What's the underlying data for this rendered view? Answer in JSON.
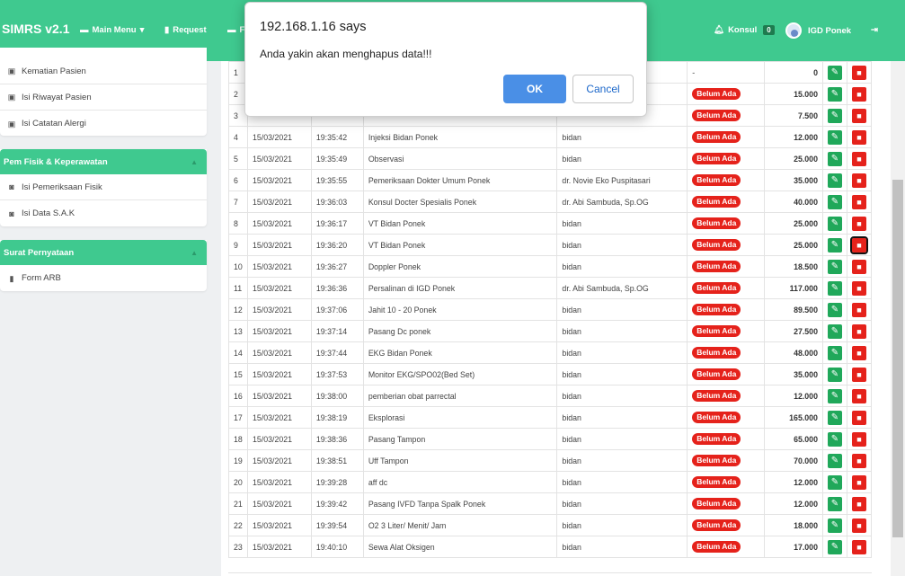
{
  "navbar": {
    "brand": "SIMRS v2.1",
    "main_menu": "Main Menu",
    "request": "Request",
    "third_item": "F",
    "konsul": "Konsul",
    "konsul_count": "0",
    "user": "IGD Ponek"
  },
  "sidebar": {
    "panel1": {
      "items": [
        "Kematian Pasien",
        "Isi Riwayat Pasien",
        "Isi Catatan Alergi"
      ]
    },
    "panel2": {
      "title": "Pem Fisik & Keperawatan",
      "items": [
        "Isi Pemeriksaan Fisik",
        "Isi Data S.A.K"
      ]
    },
    "panel3": {
      "title": "Surat Pernyataan",
      "items": [
        "Form ARB"
      ]
    }
  },
  "table": {
    "rows": [
      {
        "no": "1",
        "date": "",
        "time": "",
        "name": "",
        "petugas": "",
        "status": "-",
        "tarif": "0"
      },
      {
        "no": "2",
        "date": "",
        "time": "",
        "name": "",
        "petugas": "",
        "status": "Belum Ada",
        "tarif": "15.000"
      },
      {
        "no": "3",
        "date": "",
        "time": "",
        "name": "",
        "petugas": "",
        "status": "Belum Ada",
        "tarif": "7.500"
      },
      {
        "no": "4",
        "date": "15/03/2021",
        "time": "19:35:42",
        "name": "Injeksi Bidan Ponek",
        "petugas": "bidan",
        "status": "Belum Ada",
        "tarif": "12.000"
      },
      {
        "no": "5",
        "date": "15/03/2021",
        "time": "19:35:49",
        "name": "Observasi",
        "petugas": "bidan",
        "status": "Belum Ada",
        "tarif": "25.000"
      },
      {
        "no": "6",
        "date": "15/03/2021",
        "time": "19:35:55",
        "name": "Pemeriksaan Dokter Umum Ponek",
        "petugas": "dr. Novie Eko Puspitasari",
        "status": "Belum Ada",
        "tarif": "35.000"
      },
      {
        "no": "7",
        "date": "15/03/2021",
        "time": "19:36:03",
        "name": "Konsul Docter Spesialis Ponek",
        "petugas": "dr. Abi Sambuda, Sp.OG",
        "status": "Belum Ada",
        "tarif": "40.000"
      },
      {
        "no": "8",
        "date": "15/03/2021",
        "time": "19:36:17",
        "name": "VT Bidan Ponek",
        "petugas": "bidan",
        "status": "Belum Ada",
        "tarif": "25.000"
      },
      {
        "no": "9",
        "date": "15/03/2021",
        "time": "19:36:20",
        "name": "VT Bidan Ponek",
        "petugas": "bidan",
        "status": "Belum Ada",
        "tarif": "25.000"
      },
      {
        "no": "10",
        "date": "15/03/2021",
        "time": "19:36:27",
        "name": "Doppler Ponek",
        "petugas": "bidan",
        "status": "Belum Ada",
        "tarif": "18.500"
      },
      {
        "no": "11",
        "date": "15/03/2021",
        "time": "19:36:36",
        "name": "Persalinan di IGD Ponek",
        "petugas": "dr. Abi Sambuda, Sp.OG",
        "status": "Belum Ada",
        "tarif": "117.000"
      },
      {
        "no": "12",
        "date": "15/03/2021",
        "time": "19:37:06",
        "name": "Jahit 10 - 20 Ponek",
        "petugas": "bidan",
        "status": "Belum Ada",
        "tarif": "89.500"
      },
      {
        "no": "13",
        "date": "15/03/2021",
        "time": "19:37:14",
        "name": "Pasang Dc ponek",
        "petugas": "bidan",
        "status": "Belum Ada",
        "tarif": "27.500"
      },
      {
        "no": "14",
        "date": "15/03/2021",
        "time": "19:37:44",
        "name": "EKG Bidan Ponek",
        "petugas": "bidan",
        "status": "Belum Ada",
        "tarif": "48.000"
      },
      {
        "no": "15",
        "date": "15/03/2021",
        "time": "19:37:53",
        "name": "Monitor EKG/SPO02(Bed Set)",
        "petugas": "bidan",
        "status": "Belum Ada",
        "tarif": "35.000"
      },
      {
        "no": "16",
        "date": "15/03/2021",
        "time": "19:38:00",
        "name": "pemberian obat parrectal",
        "petugas": "bidan",
        "status": "Belum Ada",
        "tarif": "12.000"
      },
      {
        "no": "17",
        "date": "15/03/2021",
        "time": "19:38:19",
        "name": "Eksplorasi",
        "petugas": "bidan",
        "status": "Belum Ada",
        "tarif": "165.000"
      },
      {
        "no": "18",
        "date": "15/03/2021",
        "time": "19:38:36",
        "name": "Pasang Tampon",
        "petugas": "bidan",
        "status": "Belum Ada",
        "tarif": "65.000"
      },
      {
        "no": "19",
        "date": "15/03/2021",
        "time": "19:38:51",
        "name": "Uff Tampon",
        "petugas": "bidan",
        "status": "Belum Ada",
        "tarif": "70.000"
      },
      {
        "no": "20",
        "date": "15/03/2021",
        "time": "19:39:28",
        "name": "aff dc",
        "petugas": "bidan",
        "status": "Belum Ada",
        "tarif": "12.000"
      },
      {
        "no": "21",
        "date": "15/03/2021",
        "time": "19:39:42",
        "name": "Pasang IVFD Tanpa Spalk Ponek",
        "petugas": "bidan",
        "status": "Belum Ada",
        "tarif": "12.000"
      },
      {
        "no": "22",
        "date": "15/03/2021",
        "time": "19:39:54",
        "name": "O2 3 Liter/ Menit/ Jam",
        "petugas": "bidan",
        "status": "Belum Ada",
        "tarif": "18.000"
      },
      {
        "no": "23",
        "date": "15/03/2021",
        "time": "19:40:10",
        "name": "Sewa Alat Oksigen",
        "petugas": "bidan",
        "status": "Belum Ada",
        "tarif": "17.000"
      }
    ]
  },
  "dialog": {
    "title": "192.168.1.16 says",
    "message": "Anda yakin akan menghapus data!!!",
    "ok_label": "OK",
    "cancel_label": "Cancel"
  },
  "colors": {
    "accent": "#3fc98f",
    "danger": "#e5221b",
    "success": "#20a85a",
    "dialog_primary": "#4a8fe6"
  }
}
